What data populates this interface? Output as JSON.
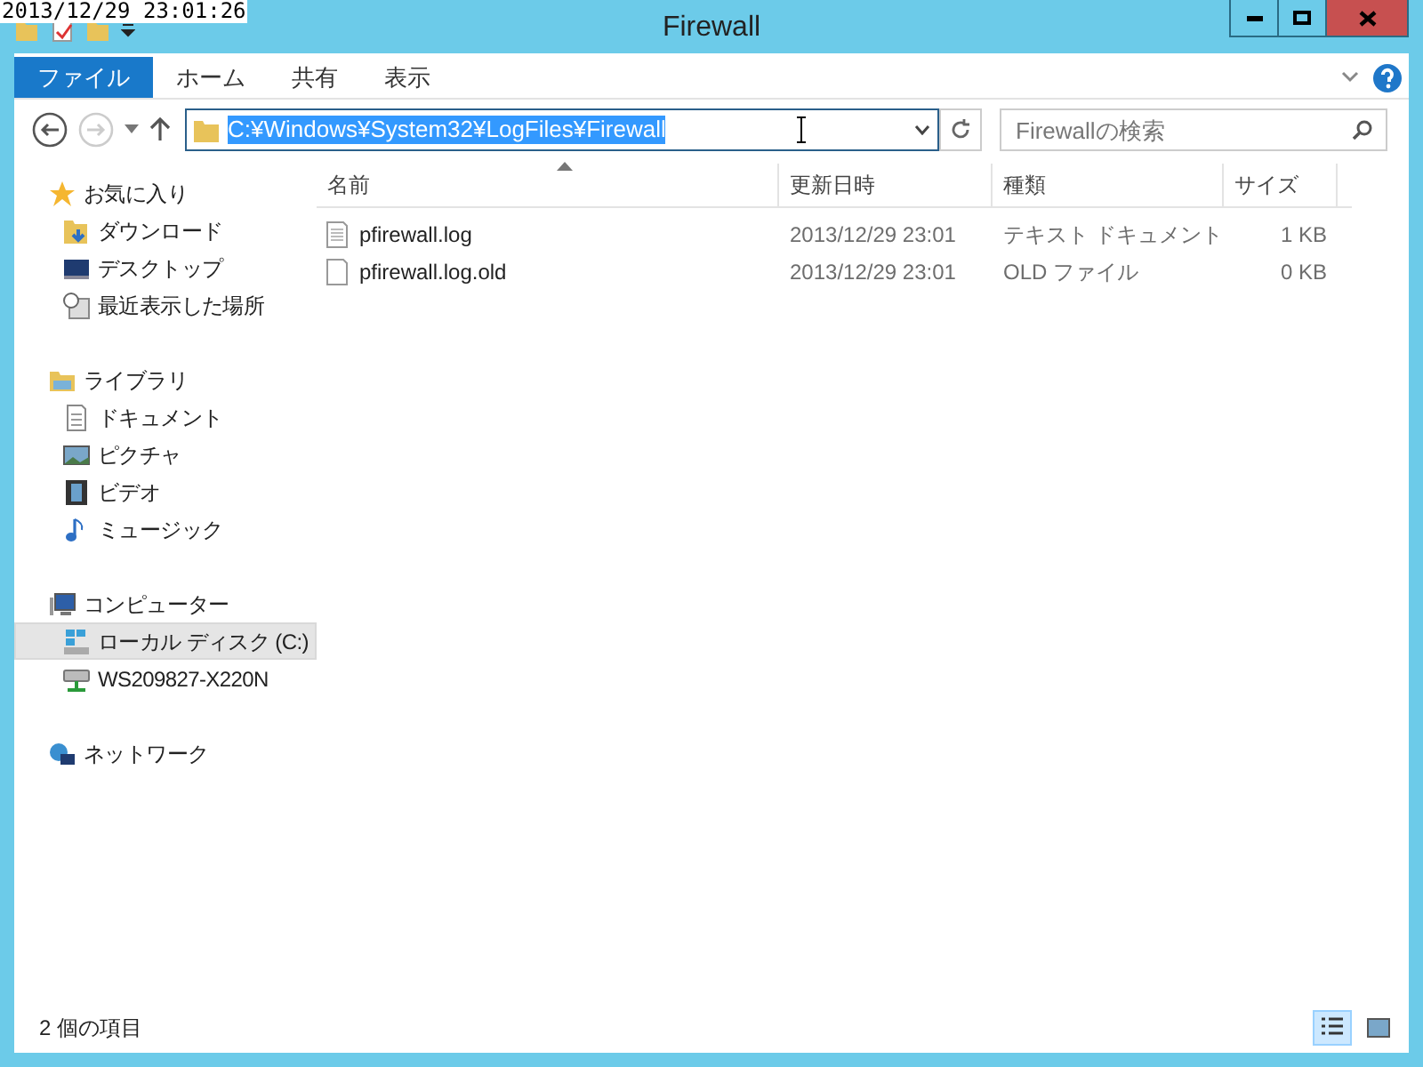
{
  "clock": "2013/12/29 23:01:26",
  "window": {
    "title": "Firewall"
  },
  "ribbon_tabs": [
    {
      "label": "ファイル",
      "selected": true
    },
    {
      "label": "ホーム",
      "selected": false
    },
    {
      "label": "共有",
      "selected": false
    },
    {
      "label": "表示",
      "selected": false
    }
  ],
  "address": {
    "value": "C:¥Windows¥System32¥LogFiles¥Firewall"
  },
  "search": {
    "placeholder": "Firewallの検索"
  },
  "nav": [
    {
      "label": "お気に入り",
      "selected": false,
      "children": [
        {
          "label": "ダウンロード",
          "selected": false
        },
        {
          "label": "デスクトップ",
          "selected": false
        },
        {
          "label": "最近表示した場所",
          "selected": false
        }
      ]
    },
    {
      "label": "ライブラリ",
      "selected": false,
      "children": [
        {
          "label": "ドキュメント",
          "selected": false
        },
        {
          "label": "ピクチャ",
          "selected": false
        },
        {
          "label": "ビデオ",
          "selected": false
        },
        {
          "label": "ミュージック",
          "selected": false
        }
      ]
    },
    {
      "label": "コンピューター",
      "selected": false,
      "children": [
        {
          "label": "ローカル ディスク (C:)",
          "selected": true
        },
        {
          "label": "WS209827-X220N",
          "selected": false
        }
      ]
    },
    {
      "label": "ネットワーク",
      "selected": false
    }
  ],
  "table": {
    "columns": [
      "名前",
      "更新日時",
      "種類",
      "サイズ"
    ],
    "rows": [
      {
        "kind": "text",
        "name": "pfirewall.log",
        "modified": "2013/12/29 23:01",
        "type": "テキスト ドキュメント",
        "size": "1 KB"
      },
      {
        "kind": "blank",
        "name": "pfirewall.log.old",
        "modified": "2013/12/29 23:01",
        "type": "OLD ファイル",
        "size": "0 KB"
      }
    ]
  },
  "status_bar": {
    "text": "2 個の項目"
  },
  "views": [
    {
      "kind": "details",
      "selected": true
    },
    {
      "kind": "large",
      "selected": false
    }
  ]
}
